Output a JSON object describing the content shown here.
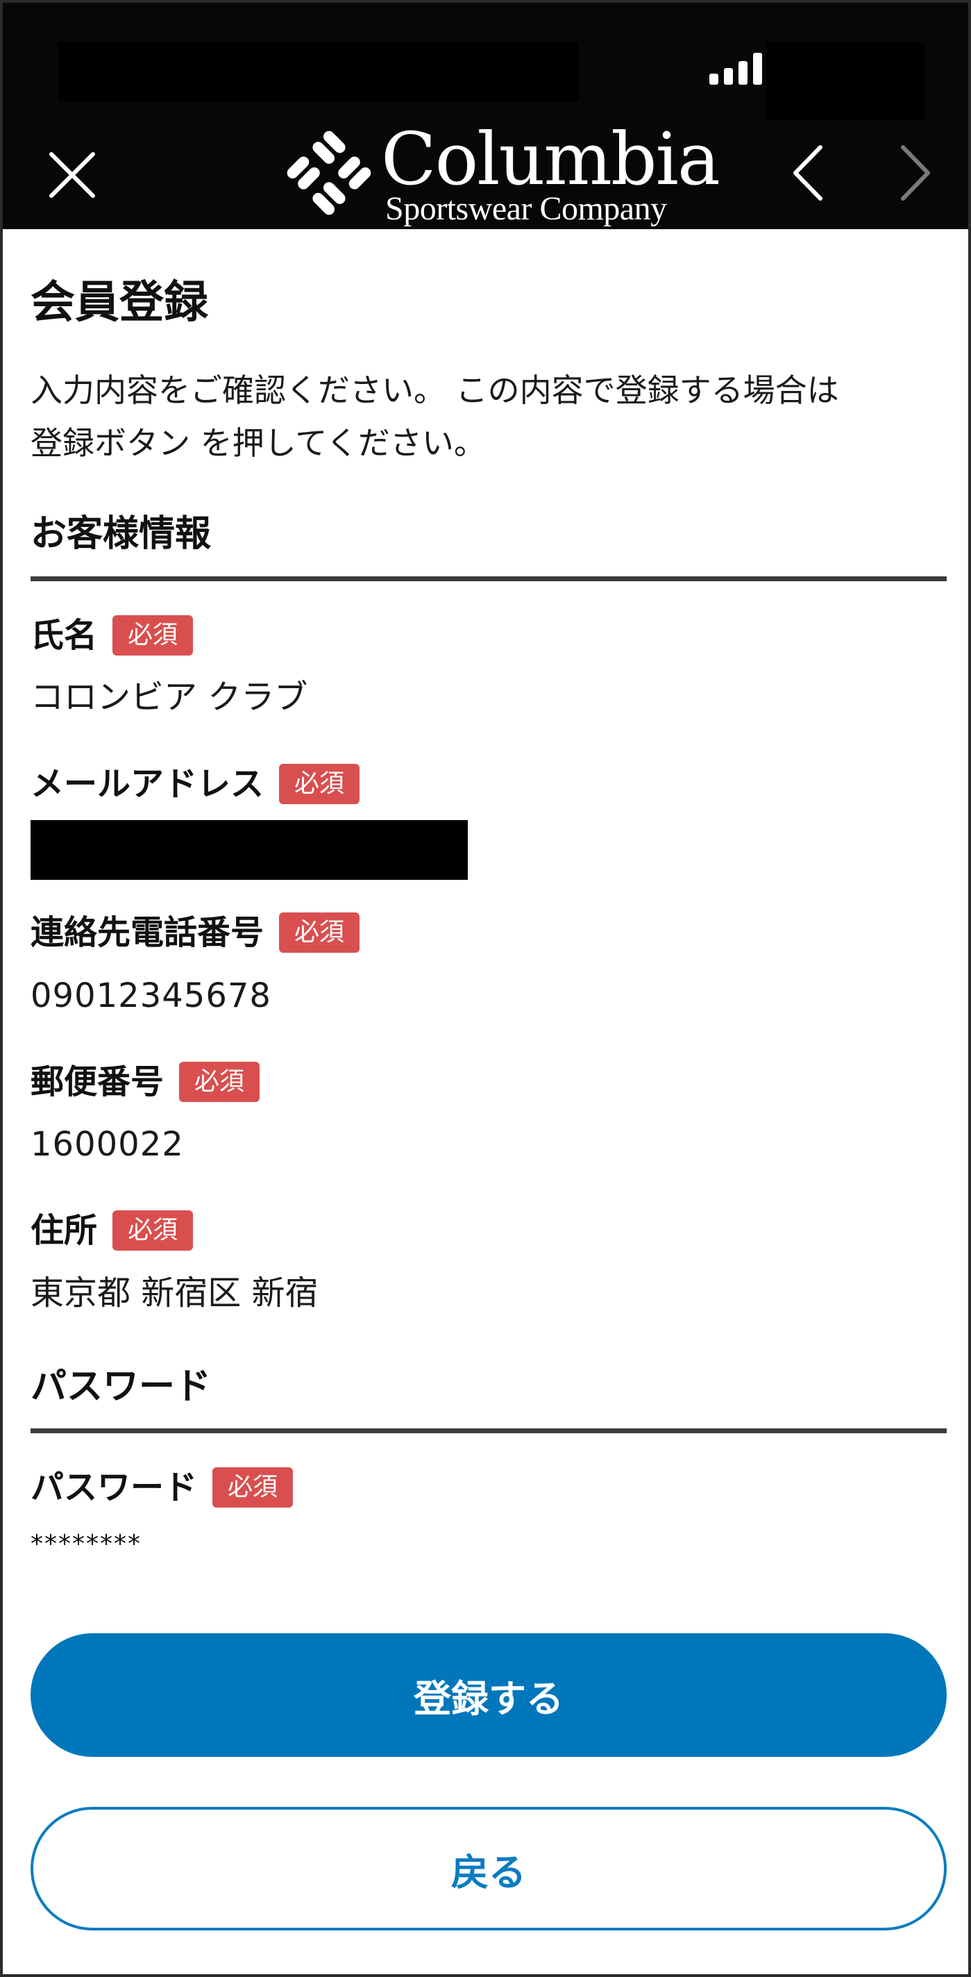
{
  "header": {
    "brand_title": "Columbia",
    "brand_subtitle": "Sportswear Company",
    "close_icon": "close-icon",
    "back_icon": "chevron-left-icon",
    "forward_icon": "chevron-right-icon",
    "background": "#050708"
  },
  "page": {
    "title": "会員登録",
    "intro_line1": "入力内容をご確認ください。 この内容で登録する場合は",
    "intro_line2": "登録ボタン を押してください。"
  },
  "sections": {
    "customer": {
      "title": "お客様情報",
      "fields": {
        "name": {
          "label": "氏名",
          "badge": "必須",
          "value": "コロンビア クラブ"
        },
        "email": {
          "label": "メールアドレス",
          "badge": "必須",
          "value": ""
        },
        "phone": {
          "label": "連絡先電話番号",
          "badge": "必須",
          "value": "09012345678"
        },
        "postal": {
          "label": "郵便番号",
          "badge": "必須",
          "value": "1600022"
        },
        "address": {
          "label": "住所",
          "badge": "必須",
          "value": "東京都 新宿区 新宿"
        }
      }
    },
    "password": {
      "title": "パスワード",
      "fields": {
        "password": {
          "label": "パスワード",
          "badge": "必須",
          "value": "********"
        }
      }
    }
  },
  "actions": {
    "submit_label": "登録する",
    "back_label": "戻る"
  },
  "colors": {
    "required_badge": "#d94f4f",
    "primary_button": "#0077bb",
    "secondary_border": "#0b7cc0"
  }
}
